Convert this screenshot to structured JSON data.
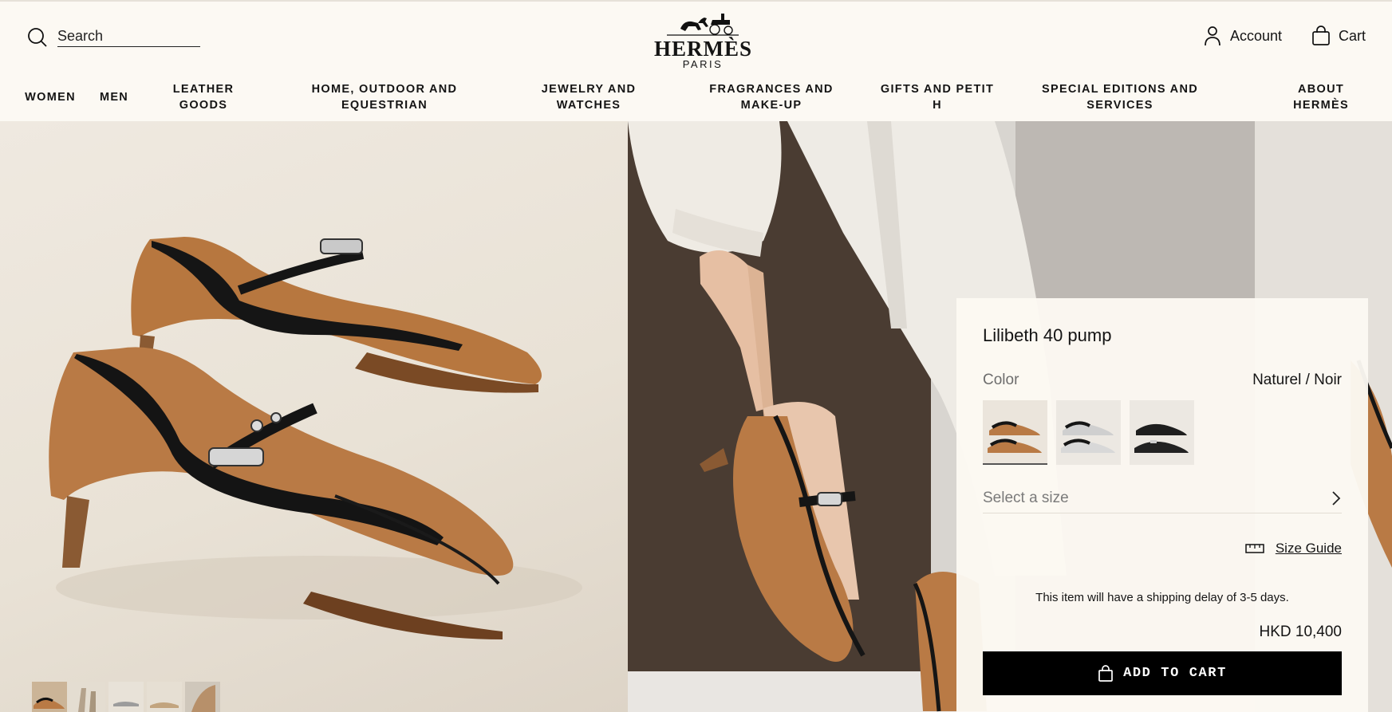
{
  "header": {
    "search_placeholder": "Search",
    "logo_word": "HERMÈS",
    "logo_sub": "PARIS",
    "account_label": "Account",
    "cart_label": "Cart"
  },
  "nav": [
    "WOMEN",
    "MEN",
    "LEATHER GOODS",
    "HOME, OUTDOOR AND EQUESTRIAN",
    "JEWELRY AND WATCHES",
    "FRAGRANCES AND MAKE-UP",
    "GIFTS AND PETIT H",
    "SPECIAL EDITIONS AND SERVICES",
    "ABOUT HERMÈS"
  ],
  "product": {
    "name": "Lilibeth 40 pump",
    "color_label": "Color",
    "color_value": "Naturel / Noir",
    "size_prompt": "Select a size",
    "size_guide": "Size Guide",
    "shipping_note": "This item will have a shipping delay of 3-5 days.",
    "price": "HKD 10,400",
    "add_to_cart": "ADD TO CART"
  },
  "swatches": [
    {
      "name": "naturel-noir",
      "upper": "#b97a45",
      "trim": "#1a1a1a",
      "selected": true
    },
    {
      "name": "silver-noir",
      "upper": "#cfcfcf",
      "trim": "#1a1a1a",
      "selected": false
    },
    {
      "name": "noir",
      "upper": "#1e1e1e",
      "trim": "#0c0c0c",
      "selected": false
    }
  ],
  "colors": {
    "accent": "#000000",
    "background": "#fcf9f3",
    "leather": "#b97a45"
  }
}
